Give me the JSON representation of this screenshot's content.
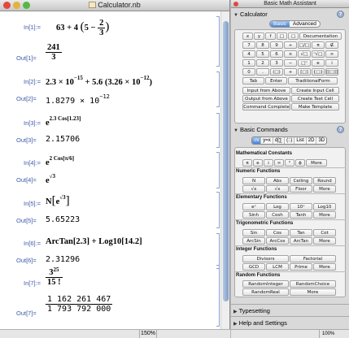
{
  "notebook": {
    "title": "Calculator.nb",
    "zoom": "150%",
    "cells": [
      {
        "in": "In[1]:=",
        "out": "Out[1]=",
        "out_num": "241",
        "out_den": "3",
        "in_a": "63 + 4",
        "in_b": "5 −",
        "in_frac_n": "2",
        "in_frac_d": "3"
      },
      {
        "in": "In[2]:=",
        "out": "Out[2]=",
        "in_text": "2.3 × 10",
        "in_exp": "−15",
        "in_text2": "+ 5.6",
        "in_paren": "3.26 × 10",
        "in_exp2": "−12",
        "out_text": "1.8279 × 10",
        "out_exp": "−12"
      },
      {
        "in": "In[3]:=",
        "out": "Out[3]=",
        "in_base": "e",
        "in_exp": "2.3 Cos[1.23]",
        "out_text": "2.15706"
      },
      {
        "in": "In[4]:=",
        "out": "Out[4]=",
        "in_base": "e",
        "in_exp": "2 Cos[π/6]",
        "out_base": "e",
        "out_exp": "√3"
      },
      {
        "in": "In[5]:=",
        "out": "Out[5]=",
        "in_text": "N",
        "in_base": "e",
        "in_exp": "√3",
        "out_text": "5.65223"
      },
      {
        "in": "In[6]:=",
        "out": "Out[6]=",
        "in_text": "ArcTan[2.3] + Log10[14.2]",
        "out_text": "2.31296"
      },
      {
        "in": "In[7]:=",
        "out": "Out[7]=",
        "in_num": "3",
        "in_num_exp": "25",
        "in_den": "15 !",
        "out_num": "1 162 261 467",
        "out_den": "1 793 792 000"
      }
    ]
  },
  "palette": {
    "title": "Basic Math Assistant",
    "calculator": {
      "header": "Calculator",
      "tabs": [
        "Basic",
        "Advanced"
      ],
      "keys_row1": [
        "x",
        "y",
        "f",
        "□",
        "□",
        "Documentation"
      ],
      "keys_row2": [
        "7",
        "8",
        "9",
        "÷",
        "□/□",
        "π",
        "∉"
      ],
      "keys_row3": [
        "4",
        "5",
        "6",
        "×",
        "√□",
        "ⁿ√□",
        "∞"
      ],
      "keys_row4": [
        "1",
        "2",
        "3",
        "−",
        "□ⁿ",
        "e",
        "i"
      ],
      "keys_row5": [
        "0",
        ".",
        "(□)",
        "+",
        "[□]",
        "{□}",
        "[[□]]"
      ],
      "keys_row6": [
        "Tab",
        "Enter",
        "TraditionalForm"
      ],
      "actions": [
        "Input from Above",
        "Create Input Cell",
        "Output from Above",
        "Create Text Cell",
        "Command Complete",
        "Make Template"
      ]
    },
    "basic_commands": {
      "header": "Basic Commands",
      "icon_tabs": [
        "√x",
        "y=x",
        "d∫∑",
        "(::)",
        "List",
        "2D",
        "3D"
      ],
      "groups": [
        {
          "title": "Mathematical Constants",
          "items": [
            "π",
            "e",
            "i",
            "∞",
            "°",
            "ϕ",
            "More"
          ]
        },
        {
          "title": "Numeric Functions",
          "items": [
            "N",
            "Abs",
            "Ceiling",
            "Round",
            "√x",
            "√x",
            "Floor",
            "More"
          ]
        },
        {
          "title": "Elementary Functions",
          "items": [
            "eˣ",
            "Log",
            "10ˣ",
            "Log10",
            "Sinh",
            "Cosh",
            "Tanh",
            "More"
          ]
        },
        {
          "title": "Trigonometric Functions",
          "items": [
            "Sin",
            "Cos",
            "Tan",
            "Cot",
            "ArcSin",
            "ArcCos",
            "ArcTan",
            "More"
          ]
        },
        {
          "title": "Integer Functions",
          "items": [
            "Divisors",
            "Factorial",
            "GCD",
            "LCM",
            "Prime",
            "More"
          ]
        },
        {
          "title": "Random Functions",
          "items": [
            "RandomInteger",
            "RandomChoice",
            "RandomReal",
            "More"
          ]
        }
      ]
    },
    "typesetting": "Typesetting",
    "help": "Help and Settings",
    "zoom": "100%"
  }
}
